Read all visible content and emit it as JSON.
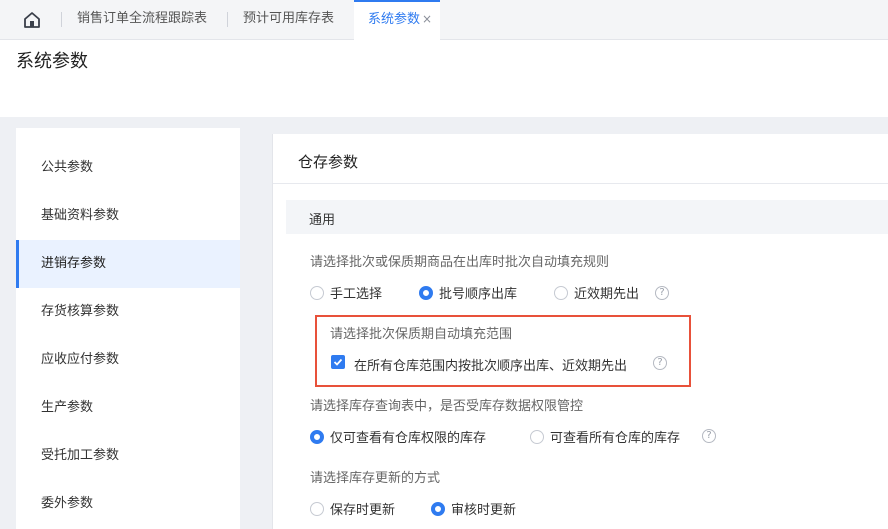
{
  "tabs": [
    {
      "label": "销售订单全流程跟踪表"
    },
    {
      "label": "预计可用库存表"
    },
    {
      "label": "系统参数",
      "close": "×"
    }
  ],
  "header": {
    "title": "系统参数"
  },
  "sidebar": {
    "items": [
      {
        "label": "公共参数"
      },
      {
        "label": "基础资料参数"
      },
      {
        "label": "进销存参数"
      },
      {
        "label": "存货核算参数"
      },
      {
        "label": "应收应付参数"
      },
      {
        "label": "生产参数"
      },
      {
        "label": "受托加工参数"
      },
      {
        "label": "委外参数"
      }
    ],
    "active_index": 2
  },
  "panel": {
    "title": "仓存参数",
    "section": "通用",
    "q1": {
      "label": "请选择批次或保质期商品在出库时批次自动填充规则",
      "options": [
        "手工选择",
        "批号顺序出库",
        "近效期先出"
      ],
      "selected": "批号顺序出库"
    },
    "q2": {
      "label": "请选择批次保质期自动填充范围",
      "checkbox_label": "在所有仓库范围内按批次顺序出库、近效期先出",
      "checked": true
    },
    "q3": {
      "label": "请选择库存查询表中，是否受库存数据权限管控",
      "options": [
        "仅可查看有仓库权限的库存",
        "可查看所有仓库的库存"
      ],
      "selected": "仅可查看有仓库权限的库存"
    },
    "q4": {
      "label": "请选择库存更新的方式",
      "options": [
        "保存时更新",
        "审核时更新"
      ],
      "selected": "审核时更新"
    },
    "help_glyph": "?"
  },
  "colors": {
    "accent": "#2f7bf0",
    "highlight": "#e8513a"
  }
}
